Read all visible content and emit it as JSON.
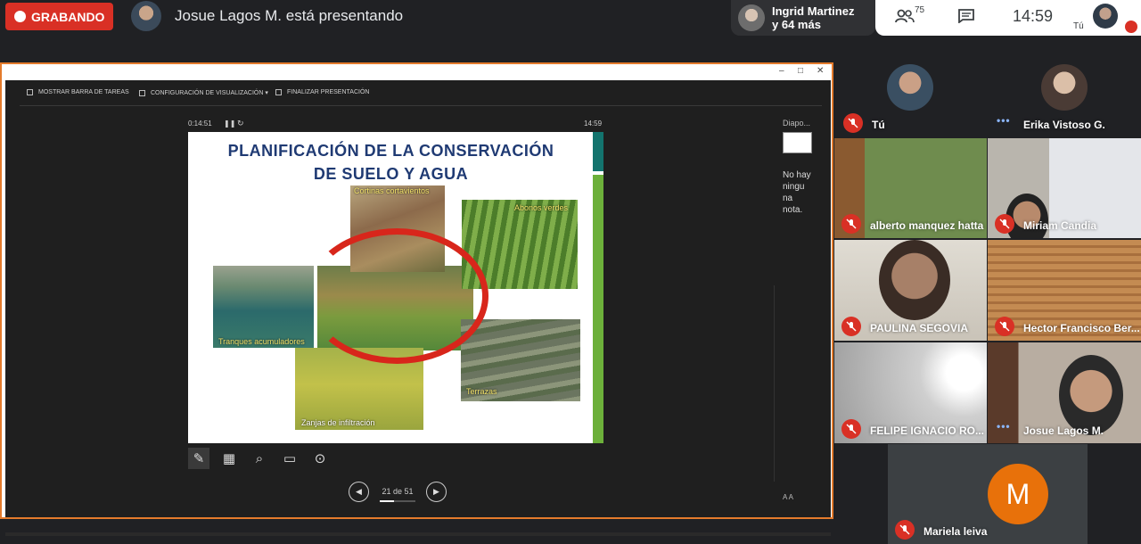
{
  "meet": {
    "recording_label": "GRABANDO",
    "presenter_text": "Josue Lagos M. está presentando",
    "viewers": {
      "line1": "Ingrid Martinez",
      "line2": "y 64 más"
    },
    "people_count": "75",
    "time": "14:59",
    "self_label": "Tú"
  },
  "presentation": {
    "toolbar": {
      "show_taskbar": "MOSTRAR BARRA DE TAREAS",
      "display_settings": "CONFIGURACIÓN DE VISUALIZACIÓN ▾",
      "end_show": "FINALIZAR PRESENTACIÓN"
    },
    "elapsed": "0:14:51",
    "clock": "14:59",
    "slide": {
      "title_line1": "PLANIFICACIÓN DE LA CONSERVACIÓN",
      "title_line2": "DE SUELO Y AGUA",
      "labels": {
        "top": "Cortinas cortavientos",
        "topright": "Abonos verdes",
        "left": "Tranques acumuladores",
        "bottom": "Zanjas de infiltración",
        "right": "Terrazas"
      }
    },
    "slide_counter": "21 de 51",
    "progress": 0.41,
    "notes_header": "Diapo...",
    "notes_text": "No hay ningu na nota.",
    "text_size_label": "A  A"
  },
  "participants": [
    {
      "name": "Tú",
      "muted": true
    },
    {
      "name": "Erika Vistoso G.",
      "speaking": true
    },
    {
      "name": "alberto manquez hatta",
      "muted": true
    },
    {
      "name": "Miriam Candia",
      "muted": true
    },
    {
      "name": "PAULINA SEGOVIA",
      "muted": true
    },
    {
      "name": "Hector Francisco Ber...",
      "muted": true
    },
    {
      "name": "FELIPE IGNACIO RO...",
      "muted": true
    },
    {
      "name": "Josue Lagos M.",
      "speaking": true
    },
    {
      "name": "Mariela leiva",
      "muted": true,
      "initial": "M"
    }
  ],
  "colors": {
    "accent_red": "#d93025",
    "border_orange": "#e47b2c",
    "avatar_orange": "#e8710a",
    "speaking_blue": "#8ab4f8"
  }
}
